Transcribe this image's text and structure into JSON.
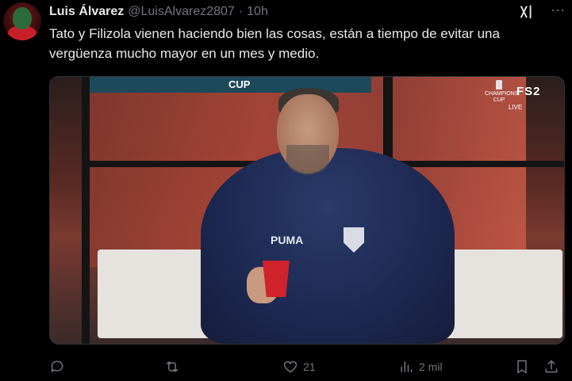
{
  "tweet": {
    "author_name": "Luis Álvarez",
    "handle": "@LuisAlvarez2807",
    "separator": "·",
    "time": "10h",
    "text": "Tato y Filizola vienen haciendo bien las cosas, están a tiempo de evitar una vergüenza mucho mayor en un mes y medio."
  },
  "media": {
    "banner_text": "CUP",
    "broadcast_logo": "CHAMPIONS CUP",
    "channel": "FS2",
    "live_label": "LIVE",
    "brand_text": "PUMA"
  },
  "actions": {
    "reply_count": "",
    "retweet_count": "",
    "like_count": "21",
    "views_count": "2 mil"
  },
  "icons": {
    "reply": "reply-icon",
    "retweet": "retweet-icon",
    "like": "heart-icon",
    "views": "views-icon",
    "bookmark": "bookmark-icon",
    "share": "share-icon",
    "grok": "grok-icon",
    "more": "more-icon"
  }
}
